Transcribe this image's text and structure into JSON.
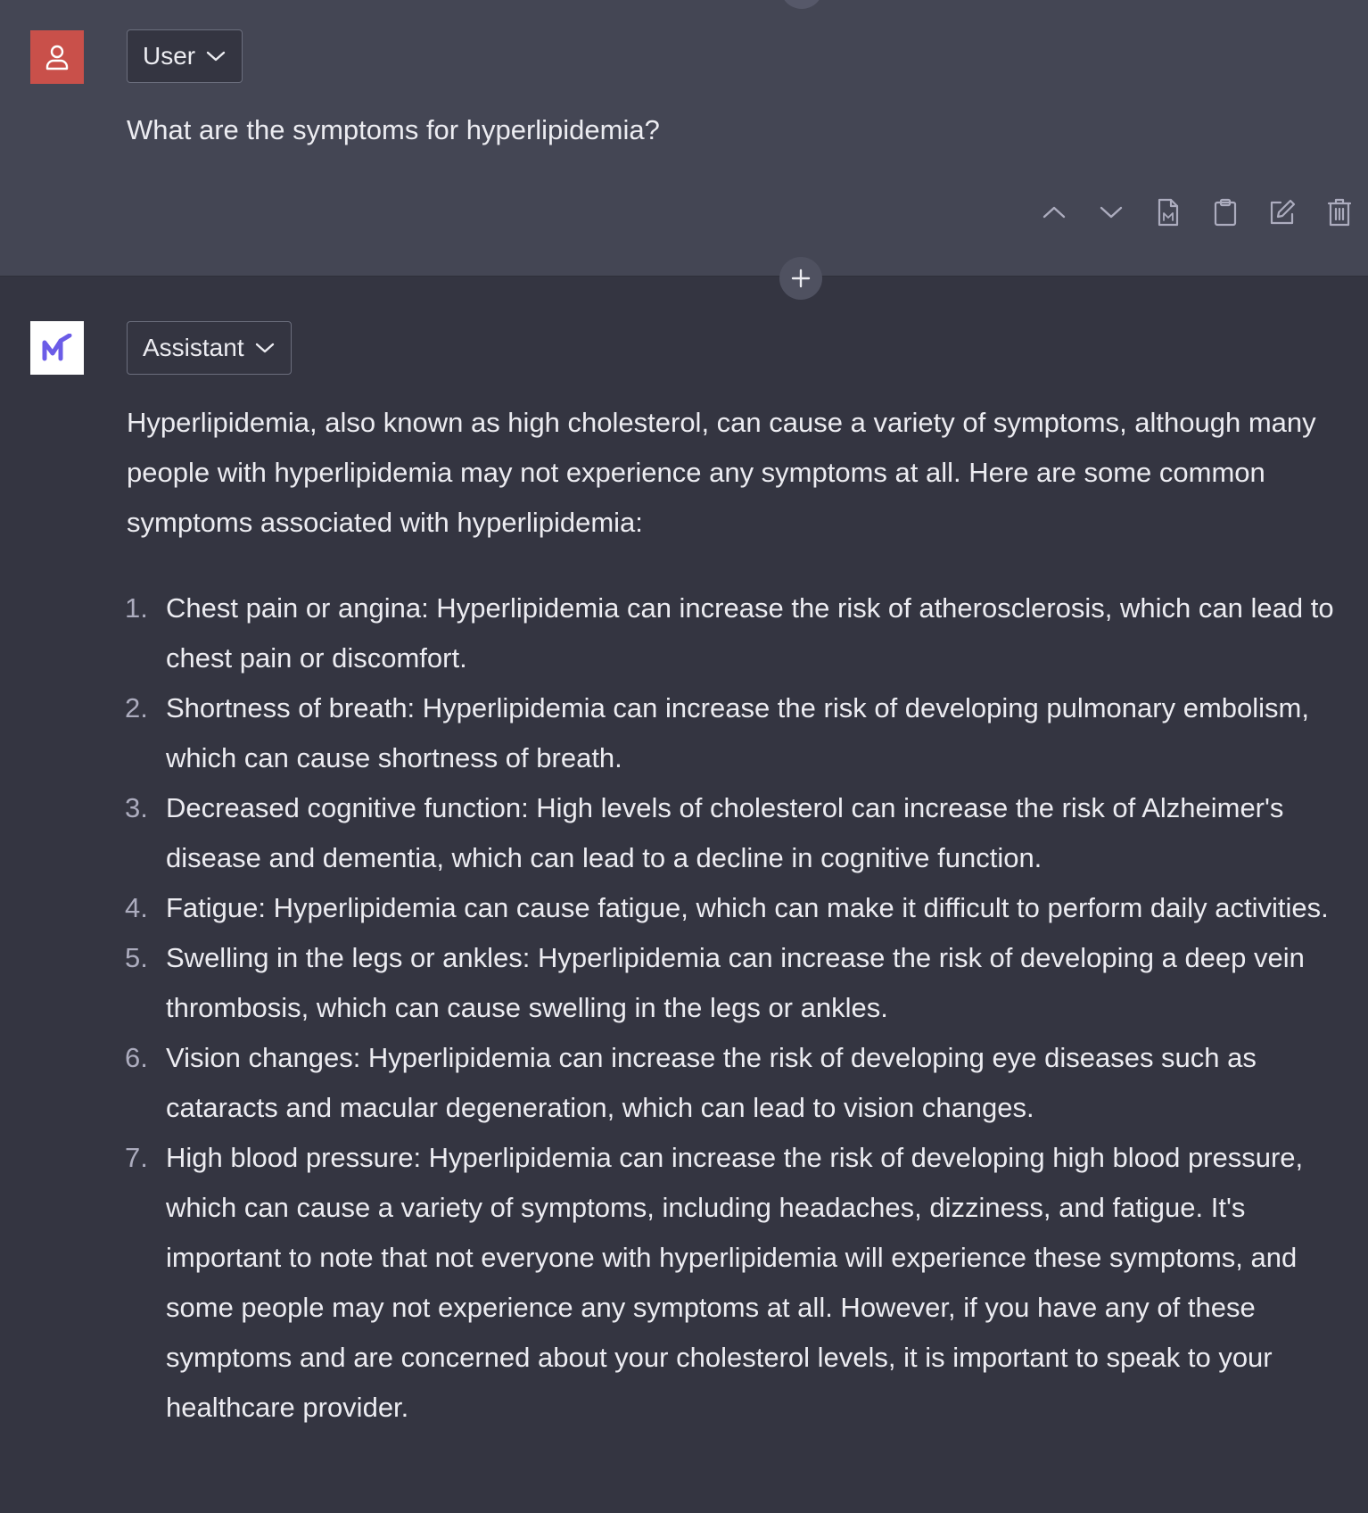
{
  "user": {
    "role_label": "User",
    "message": "What are the symptoms for hyperlipidemia?"
  },
  "actions": {
    "icons": [
      "chevron-up-icon",
      "chevron-down-icon",
      "markdown-file-icon",
      "clipboard-icon",
      "edit-icon",
      "trash-icon"
    ]
  },
  "assistant": {
    "role_label": "Assistant",
    "intro": "Hyperlipidemia, also known as high cholesterol, can cause a variety of symptoms, although many people with hyperlipidemia may not experience any symptoms at all. Here are some common symptoms associated with hyperlipidemia:",
    "items": [
      {
        "num": "1.",
        "text": "Chest pain or angina: Hyperlipidemia can increase the risk of atherosclerosis, which can lead to chest pain or discomfort."
      },
      {
        "num": "2.",
        "text": "Shortness of breath: Hyperlipidemia can increase the risk of developing pulmonary embolism, which can cause shortness of breath."
      },
      {
        "num": "3.",
        "text": "Decreased cognitive function: High levels of cholesterol can increase the risk of Alzheimer's disease and dementia, which can lead to a decline in cognitive function."
      },
      {
        "num": "4.",
        "text": "Fatigue: Hyperlipidemia can cause fatigue, which can make it difficult to perform daily activities."
      },
      {
        "num": "5.",
        "text": "Swelling in the legs or ankles: Hyperlipidemia can increase the risk of developing a deep vein thrombosis, which can cause swelling in the legs or ankles."
      },
      {
        "num": "6.",
        "text": "Vision changes: Hyperlipidemia can increase the risk of developing eye diseases such as cataracts and macular degeneration, which can lead to vision changes."
      },
      {
        "num": "7.",
        "text": "High blood pressure: Hyperlipidemia can increase the risk of developing high blood pressure, which can cause a variety of symptoms, including headaches, dizziness, and fatigue. It's important to note that not everyone with hyperlipidemia will experience these symptoms, and some people may not experience any symptoms at all. However, if you have any of these symptoms and are concerned about your cholesterol levels, it is important to speak to your healthcare provider."
      }
    ]
  },
  "colors": {
    "user_bg": "#444654",
    "assistant_bg": "#343541",
    "user_avatar": "#c9504a",
    "logo": "#6b5ce7",
    "text": "#ececf1"
  }
}
